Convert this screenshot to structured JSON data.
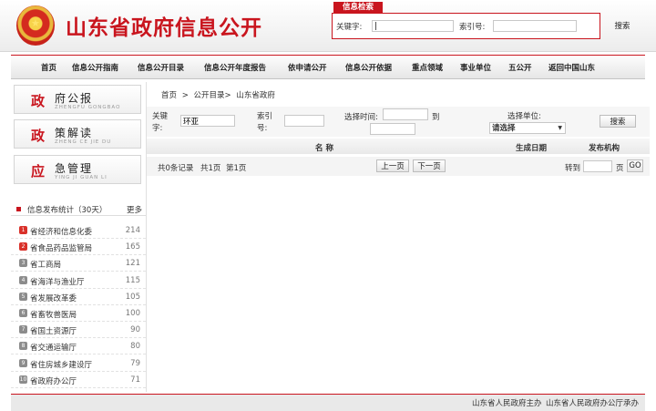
{
  "header": {
    "site_title": "山东省政府信息公开",
    "search_tab": "信息检索",
    "keyword_label": "关键字:",
    "keyword_value": "|",
    "index_label": "索引号:",
    "index_value": "",
    "search_button": "搜索"
  },
  "nav": [
    "首页",
    "信息公开指南",
    "信息公开目录",
    "信息公开年度报告",
    "依申请公开",
    "信息公开依据",
    "重点领域",
    "事业单位",
    "五公开",
    "返回中国山东"
  ],
  "sidebar": {
    "buttons": [
      {
        "big": "政",
        "zh": "府公报",
        "py": "ZHENGFU GONGBAO"
      },
      {
        "big": "政",
        "zh": "策解读",
        "py": "ZHENG CE JIE DU"
      },
      {
        "big": "应",
        "zh": "急管理",
        "py": "YING JI GUAN LI"
      }
    ],
    "stats_title": "信息发布统计（30天）",
    "more": "更多",
    "stats": [
      {
        "rank": "1",
        "name": "省经济和信息化委",
        "count": "214"
      },
      {
        "rank": "2",
        "name": "省食品药品监管局",
        "count": "165"
      },
      {
        "rank": "3",
        "name": "省工商局",
        "count": "121"
      },
      {
        "rank": "4",
        "name": "省海洋与渔业厅",
        "count": "115"
      },
      {
        "rank": "5",
        "name": "省发展改革委",
        "count": "105"
      },
      {
        "rank": "6",
        "name": "省畜牧兽医局",
        "count": "100"
      },
      {
        "rank": "7",
        "name": "省国土资源厅",
        "count": "90"
      },
      {
        "rank": "8",
        "name": "省交通运输厅",
        "count": "80"
      },
      {
        "rank": "9",
        "name": "省住房城乡建设厅",
        "count": "79"
      },
      {
        "rank": "10",
        "name": "省政府办公厅",
        "count": "71"
      }
    ]
  },
  "breadcrumb": [
    "首页",
    ">",
    "公开目录>",
    "山东省政府"
  ],
  "filter": {
    "keyword_label_1": "关键",
    "keyword_label_2": "字:",
    "keyword_value": "环亚",
    "index_label_1": "索引",
    "index_label_2": "号:",
    "index_value": "",
    "time_label": "选择时间:",
    "to_label": "到",
    "unit_label": "选择单位:",
    "unit_selected": "请选择",
    "search_button": "搜索"
  },
  "table": {
    "col_name": "名 称",
    "col_date": "生成日期",
    "col_org": "发布机构"
  },
  "pager": {
    "total": "共0条记录",
    "pages": "共1页",
    "current": "第1页",
    "prev": "上一页",
    "next": "下一页",
    "goto_label": "转到",
    "page_unit": "页",
    "go": "GO"
  },
  "footer": {
    "sponsor": "山东省人民政府主办",
    "organizer": "山东省人民政府办公厅承办"
  },
  "colors": {
    "accent": "#c9151e",
    "rank_top": "#d9312a",
    "rank_other": "#8c8c8c"
  }
}
